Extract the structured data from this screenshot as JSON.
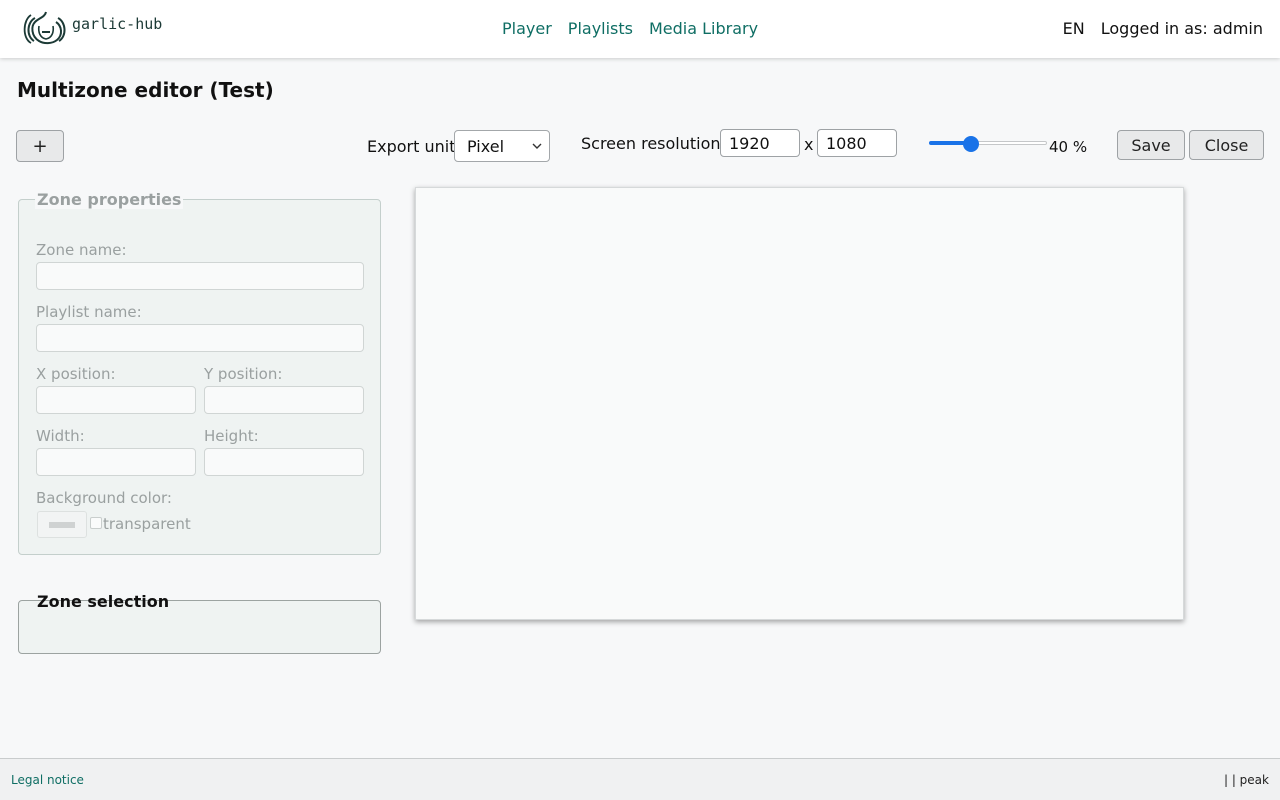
{
  "header": {
    "brand": "garlic-hub",
    "nav": [
      "Player",
      "Playlists",
      "Media Library"
    ],
    "language": "EN",
    "user_status": "Logged in as: admin"
  },
  "page": {
    "title": "Multizone editor (Test)"
  },
  "toolbar": {
    "add_label": "+",
    "export_unit_label": "Export unit",
    "export_unit_value": "Pixel",
    "screen_resolution_label": "Screen resolution:",
    "resolution_width": "1920",
    "resolution_separator": "x",
    "resolution_height": "1080",
    "zoom_percent": 40,
    "zoom_label": "40 %",
    "save_label": "Save",
    "close_label": "Close"
  },
  "zone_properties": {
    "legend": "Zone properties",
    "zone_name_label": "Zone name:",
    "playlist_name_label": "Playlist name:",
    "x_position_label": "X position:",
    "y_position_label": "Y position:",
    "width_label": "Width:",
    "height_label": "Height:",
    "background_color_label": "Background color:",
    "transparent_label": "transparent"
  },
  "zone_selection": {
    "legend": "Zone selection"
  },
  "footer": {
    "legal_notice": "Legal notice",
    "right_text": "| | peak"
  },
  "colors": {
    "accent": "#0f6e64",
    "slider": "#1a73e8"
  },
  "icons": {
    "logo": "garlic-logo-icon",
    "select": "chevron-down-icon"
  }
}
